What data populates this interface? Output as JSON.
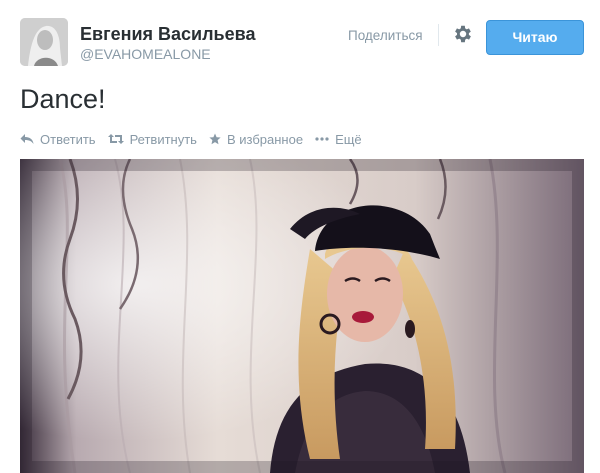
{
  "profile": {
    "name": "Евгения Васильева",
    "handle": "@EVAHOMEALONE",
    "avatar_icon": "user-avatar"
  },
  "header": {
    "share_label": "Поделиться",
    "settings_icon": "gear-icon",
    "follow_label": "Читаю",
    "follow_color": "#55acee"
  },
  "tweet": {
    "text": "Dance!"
  },
  "actions": {
    "reply_label": "Ответить",
    "retweet_label": "Ретвитнуть",
    "favorite_label": "В избранное",
    "more_label": "Ещё"
  },
  "media": {
    "icon": "photo"
  },
  "colors": {
    "text": "#292f33",
    "muted": "#8899a6",
    "accent": "#55acee"
  }
}
